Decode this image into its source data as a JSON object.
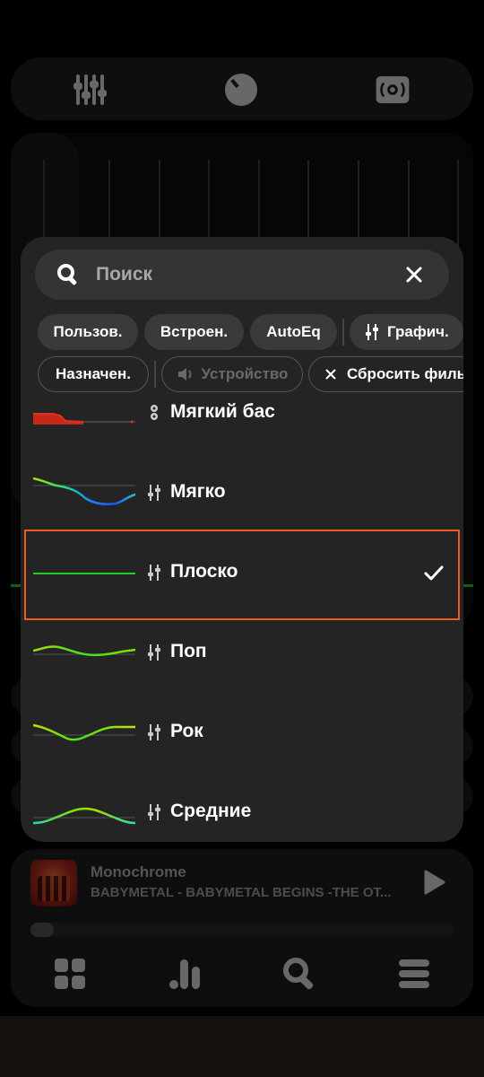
{
  "search": {
    "placeholder": "Поиск"
  },
  "filters": {
    "row1": [
      "Пользов.",
      "Встроен.",
      "AutoEq",
      "Графич."
    ],
    "row2": [
      "Назначен.",
      "Устройство",
      "Сбросить филь"
    ]
  },
  "presets": [
    {
      "name": "Мягкий бас",
      "type": "parametric",
      "color": "#e03020"
    },
    {
      "name": "Мягко",
      "type": "graphic"
    },
    {
      "name": "Плоско",
      "type": "graphic",
      "selected": true
    },
    {
      "name": "Поп",
      "type": "graphic"
    },
    {
      "name": "Рок",
      "type": "graphic"
    },
    {
      "name": "Средние",
      "type": "graphic"
    }
  ],
  "player": {
    "title": "Monochrome",
    "subtitle": "BABYMETAL - BABYMETAL BEGINS -THE OT...",
    "progress": 0.05
  },
  "colors": {
    "accent": "#e8601c",
    "flat": "#22cc22"
  }
}
